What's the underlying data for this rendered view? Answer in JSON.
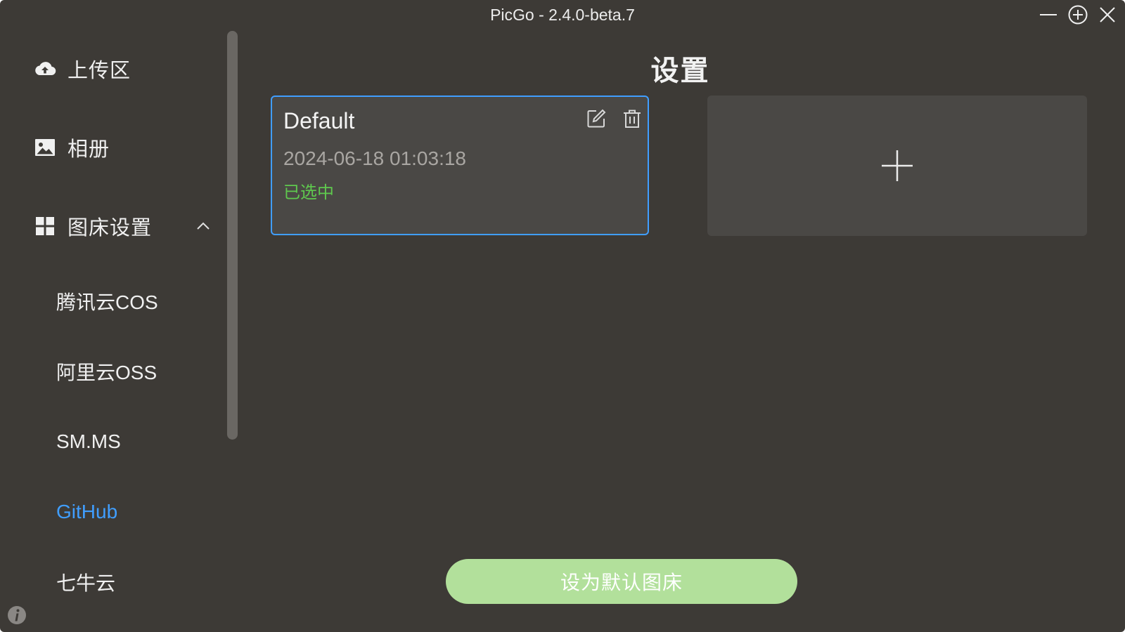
{
  "window": {
    "title": "PicGo - 2.4.0-beta.7"
  },
  "sidebar": {
    "items": [
      {
        "label": "上传区",
        "icon": "cloud-upload-icon"
      },
      {
        "label": "相册",
        "icon": "image-icon"
      },
      {
        "label": "图床设置",
        "icon": "grid-icon",
        "expanded": true
      }
    ],
    "sub_items": [
      {
        "label": "腾讯云COS",
        "active": false
      },
      {
        "label": "阿里云OSS",
        "active": false
      },
      {
        "label": "SM.MS",
        "active": false
      },
      {
        "label": "GitHub",
        "active": true
      },
      {
        "label": "七牛云",
        "active": false
      }
    ]
  },
  "main": {
    "title": "设置",
    "config_card": {
      "name": "Default",
      "date": "2024-06-18 01:03:18",
      "status": "已选中"
    },
    "default_button_label": "设为默认图床"
  },
  "colors": {
    "background": "#3d3a36",
    "card": "#4a4845",
    "accent_blue": "#409eff",
    "selected_green": "#5fc94e",
    "button_green": "#b2e09b"
  }
}
